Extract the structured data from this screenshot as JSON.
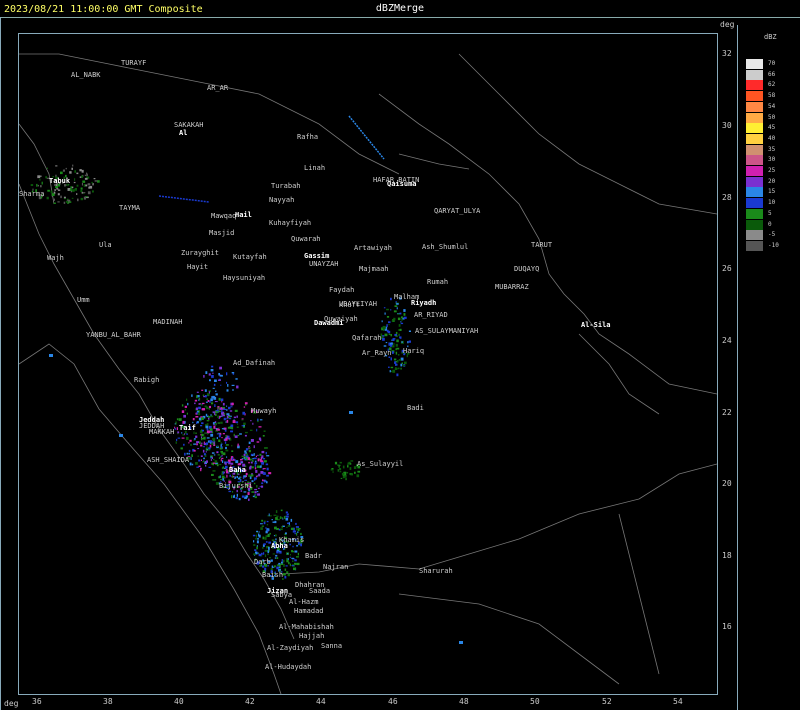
{
  "title": {
    "timestamp": "2023/08/21 11:00:00 GMT Composite",
    "product": "dBZMerge"
  },
  "axes": {
    "unit_top": "deg",
    "unit_bottom": "deg",
    "latitudes": [
      "32",
      "30",
      "28",
      "26",
      "24",
      "22",
      "20",
      "18",
      "16"
    ],
    "longitudes": [
      "36",
      "38",
      "40",
      "42",
      "44",
      "46",
      "48",
      "50",
      "52",
      "54"
    ]
  },
  "legend": {
    "unit": "dBZ",
    "levels": [
      {
        "label": "70",
        "color": "#e8e8e8"
      },
      {
        "label": "66",
        "color": "#cccccc"
      },
      {
        "label": "62",
        "color": "#ff2a2a"
      },
      {
        "label": "58",
        "color": "#ff5522"
      },
      {
        "label": "54",
        "color": "#ff8844"
      },
      {
        "label": "50",
        "color": "#ffaa44"
      },
      {
        "label": "45",
        "color": "#ffee33"
      },
      {
        "label": "40",
        "color": "#ffd040"
      },
      {
        "label": "35",
        "color": "#d09070"
      },
      {
        "label": "30",
        "color": "#cc5588"
      },
      {
        "label": "25",
        "color": "#d020b0"
      },
      {
        "label": "20",
        "color": "#7a30d0"
      },
      {
        "label": "15",
        "color": "#2a86e6"
      },
      {
        "label": "10",
        "color": "#1a3ad0"
      },
      {
        "label": "5",
        "color": "#1a8a1a"
      },
      {
        "label": "0",
        "color": "#0a5a0a"
      },
      {
        "label": "-5",
        "color": "#8a8a8a"
      },
      {
        "label": "-10",
        "color": "#555555"
      }
    ]
  },
  "cities": [
    {
      "name": "TURAYF",
      "bold": false
    },
    {
      "name": "AL_NABK",
      "bold": false
    },
    {
      "name": "AR_AR",
      "bold": false
    },
    {
      "name": "SAKAKAH",
      "bold": false
    },
    {
      "name": "Al",
      "bold": true
    },
    {
      "name": "Rafha",
      "bold": false
    },
    {
      "name": "Linah",
      "bold": false
    },
    {
      "name": "HAFAR_BATIN",
      "bold": false
    },
    {
      "name": "Qaisuma",
      "bold": true
    },
    {
      "name": "Tabuk",
      "bold": true
    },
    {
      "name": "Sharma",
      "bold": false
    },
    {
      "name": "Turabah",
      "bold": false
    },
    {
      "name": "Nayyah",
      "bold": false
    },
    {
      "name": "TAYMA",
      "bold": false
    },
    {
      "name": "Mawqaq",
      "bold": false
    },
    {
      "name": "Hail",
      "bold": true
    },
    {
      "name": "Kuhayfiyah",
      "bold": false
    },
    {
      "name": "QARYAT_ULYA",
      "bold": false
    },
    {
      "name": "Masjid",
      "bold": false
    },
    {
      "name": "Quwarah",
      "bold": false
    },
    {
      "name": "Ula",
      "bold": false
    },
    {
      "name": "Artawiyah",
      "bold": false
    },
    {
      "name": "Ash_Shumlul",
      "bold": false
    },
    {
      "name": "TARUT",
      "bold": false
    },
    {
      "name": "Wajh",
      "bold": false
    },
    {
      "name": "Zurayghit",
      "bold": false
    },
    {
      "name": "Kutayfah",
      "bold": false
    },
    {
      "name": "Gassim",
      "bold": true
    },
    {
      "name": "UNAYZAH",
      "bold": false
    },
    {
      "name": "Hayit",
      "bold": false
    },
    {
      "name": "Majmaah",
      "bold": false
    },
    {
      "name": "DUQAYQ",
      "bold": false
    },
    {
      "name": "Haysuniyah",
      "bold": false
    },
    {
      "name": "Rumah",
      "bold": false
    },
    {
      "name": "MUBARRAZ",
      "bold": false
    },
    {
      "name": "Faydah",
      "bold": false
    },
    {
      "name": "UDAYLIYAH",
      "bold": false
    },
    {
      "name": "Malham",
      "bold": false
    },
    {
      "name": "Riyadh",
      "bold": true
    },
    {
      "name": "Umm",
      "bold": false
    },
    {
      "name": "Khuff",
      "bold": false
    },
    {
      "name": "AR_RIYAD",
      "bold": false
    },
    {
      "name": "Dawadmi",
      "bold": true
    },
    {
      "name": "Al-Sila",
      "bold": true
    },
    {
      "name": "MADINAH",
      "bold": false
    },
    {
      "name": "Quwaiyah",
      "bold": false
    },
    {
      "name": "YANBU_AL_BAHR",
      "bold": false
    },
    {
      "name": "AS_SULAYMANIYAH",
      "bold": false
    },
    {
      "name": "Qafarah",
      "bold": false
    },
    {
      "name": "Ar_Rayn",
      "bold": false
    },
    {
      "name": "Hariq",
      "bold": false
    },
    {
      "name": "Ad_Dafinah",
      "bold": false
    },
    {
      "name": "Rabigh",
      "bold": false
    },
    {
      "name": "Badi",
      "bold": false
    },
    {
      "name": "Muwayh",
      "bold": false
    },
    {
      "name": "Jeddah",
      "bold": true
    },
    {
      "name": "JEDDAH",
      "bold": false
    },
    {
      "name": "MAKKAH",
      "bold": false
    },
    {
      "name": "Taif",
      "bold": true
    },
    {
      "name": "ASH_SHAIDA",
      "bold": false
    },
    {
      "name": "As_Sulayyil",
      "bold": false
    },
    {
      "name": "Baha",
      "bold": true
    },
    {
      "name": "Bijurshi",
      "bold": false
    },
    {
      "name": "Khamis",
      "bold": false
    },
    {
      "name": "Abha",
      "bold": true
    },
    {
      "name": "Badr",
      "bold": false
    },
    {
      "name": "Darb",
      "bold": false
    },
    {
      "name": "Najran",
      "bold": false
    },
    {
      "name": "Sharurah",
      "bold": false
    },
    {
      "name": "Baish",
      "bold": false
    },
    {
      "name": "Dhahran",
      "bold": false
    },
    {
      "name": "Saada",
      "bold": false
    },
    {
      "name": "Jizan",
      "bold": true
    },
    {
      "name": "Sabya",
      "bold": false
    },
    {
      "name": "Al-Hazm",
      "bold": false
    },
    {
      "name": "Hamadad",
      "bold": false
    },
    {
      "name": "Al-Mahabishah",
      "bold": false
    },
    {
      "name": "Hajjah",
      "bold": false
    },
    {
      "name": "Sanna",
      "bold": false
    },
    {
      "name": "Al-Zaydiyah",
      "bold": false
    },
    {
      "name": "Al-Hudaydah",
      "bold": false
    }
  ]
}
